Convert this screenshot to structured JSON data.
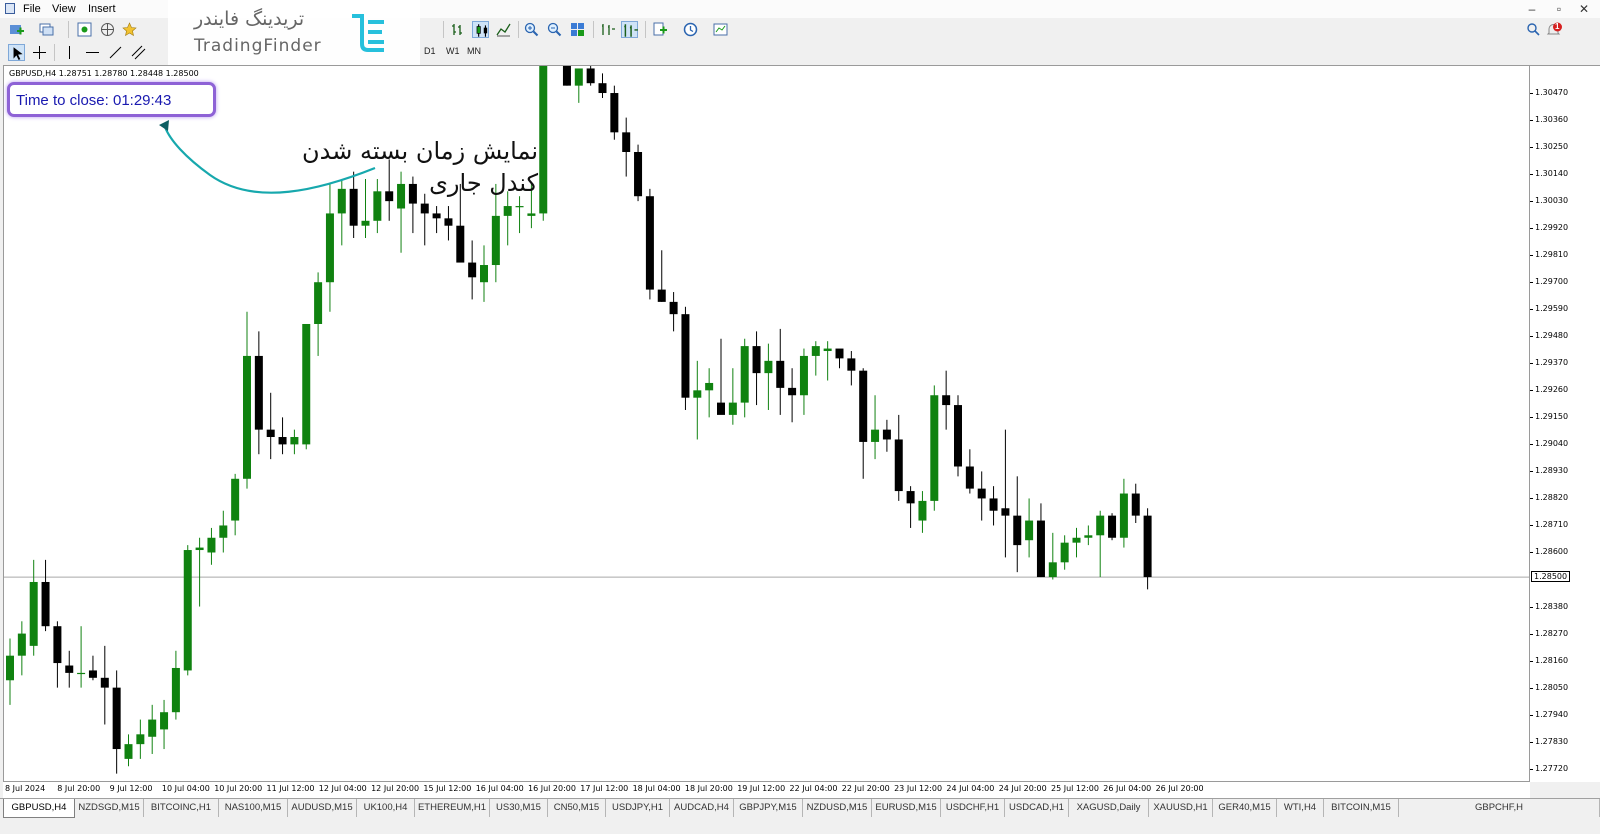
{
  "menu": {
    "items": [
      "File",
      "View",
      "Insert"
    ]
  },
  "window_buttons": {
    "minimize": "‒",
    "restore": "▫",
    "close": "✕"
  },
  "logo": {
    "fa": "تریدینگ فایندر",
    "en": "TradingFinder"
  },
  "timeframes": [
    "D1",
    "W1",
    "MN"
  ],
  "notification_badge": "1",
  "chart": {
    "title": "GBPUSD,H4  1.28751 1.28780 1.28448 1.28500",
    "current_price": "1.28500",
    "price_labels": [
      "1.30470",
      "1.30360",
      "1.30250",
      "1.30140",
      "1.30030",
      "1.29920",
      "1.29810",
      "1.29700",
      "1.29590",
      "1.29480",
      "1.29370",
      "1.29260",
      "1.29150",
      "1.29040",
      "1.28930",
      "1.28820",
      "1.28710",
      "1.28600",
      "1.28380",
      "1.28270",
      "1.28160",
      "1.28050",
      "1.27940",
      "1.27830",
      "1.27720"
    ],
    "date_labels": [
      "8 Jul 2024",
      "8 Jul 20:00",
      "9 Jul 12:00",
      "10 Jul 04:00",
      "10 Jul 20:00",
      "11 Jul 12:00",
      "12 Jul 04:00",
      "12 Jul 20:00",
      "15 Jul 12:00",
      "16 Jul 04:00",
      "16 Jul 20:00",
      "17 Jul 12:00",
      "18 Jul 04:00",
      "18 Jul 20:00",
      "19 Jul 12:00",
      "22 Jul 04:00",
      "22 Jul 20:00",
      "23 Jul 12:00",
      "24 Jul 04:00",
      "24 Jul 20:00",
      "25 Jul 12:00",
      "26 Jul 04:00",
      "26 Jul 20:00"
    ],
    "up_color": "#108210",
    "down_color": "#000000",
    "price_line_color": "#a9a9a9"
  },
  "indicator": {
    "time_to_close": "Time to close: 01:29:43",
    "highlight_color": "#8e62d6"
  },
  "annotation": {
    "line1": "نمایش زمان بسته شدن",
    "line2": "کندل جاری"
  },
  "tabs": [
    "GBPUSD,H4",
    "NZDSGD,M15",
    "BITCOINC,H1",
    "NAS100,M15",
    "AUDUSD,M15",
    "UK100,H4",
    "ETHEREUM,H1",
    "US30,M15",
    "CN50,M15",
    "USDJPY,H1",
    "AUDCAD,H4",
    "GBPJPY,M15",
    "NZDUSD,M15",
    "EURUSD,M15",
    "USDCHF,H1",
    "USDCAD,H1",
    "XAGUSD,Daily",
    "XAUUSD,H1",
    "GER40,M15",
    "WTI,H4",
    "BITCOIN,M15",
    "GBPCHF,H"
  ],
  "chart_data": {
    "type": "candlestick",
    "title": "GBPUSD,H4",
    "ohlc_header": {
      "open": 1.28751,
      "high": 1.2878,
      "low": 1.28448,
      "close": 1.285
    },
    "current_price": 1.285,
    "ylim": [
      1.2767,
      1.3058
    ],
    "xlabels": [
      "8 Jul 2024",
      "8 Jul 20:00",
      "9 Jul 12:00",
      "10 Jul 04:00",
      "10 Jul 20:00",
      "11 Jul 12:00",
      "12 Jul 04:00",
      "12 Jul 20:00",
      "15 Jul 12:00",
      "16 Jul 04:00",
      "16 Jul 20:00",
      "17 Jul 12:00",
      "18 Jul 04:00",
      "18 Jul 20:00",
      "19 Jul 12:00",
      "22 Jul 04:00",
      "22 Jul 20:00",
      "23 Jul 12:00",
      "24 Jul 04:00",
      "24 Jul 20:00",
      "25 Jul 12:00",
      "26 Jul 04:00",
      "26 Jul 20:00"
    ],
    "candles": [
      [
        1.2808,
        1.2825,
        1.2798,
        1.2818
      ],
      [
        1.2818,
        1.2832,
        1.281,
        1.2827
      ],
      [
        1.2822,
        1.2857,
        1.2818,
        1.2848
      ],
      [
        1.2848,
        1.2857,
        1.2828,
        1.283
      ],
      [
        1.283,
        1.2832,
        1.2805,
        1.2815
      ],
      [
        1.2814,
        1.282,
        1.2805,
        1.2811
      ],
      [
        1.2811,
        1.283,
        1.2805,
        1.2811
      ],
      [
        1.2812,
        1.2818,
        1.2808,
        1.2809
      ],
      [
        1.2809,
        1.2822,
        1.279,
        1.2805
      ],
      [
        1.2805,
        1.2812,
        1.277,
        1.278
      ],
      [
        1.2776,
        1.2786,
        1.2773,
        1.2782
      ],
      [
        1.2782,
        1.2792,
        1.2776,
        1.2786
      ],
      [
        1.2785,
        1.2798,
        1.2778,
        1.2792
      ],
      [
        1.2788,
        1.28,
        1.278,
        1.2795
      ],
      [
        1.2795,
        1.282,
        1.2792,
        1.2813
      ],
      [
        1.2812,
        1.2863,
        1.281,
        1.2861
      ],
      [
        1.2861,
        1.2866,
        1.2838,
        1.2862
      ],
      [
        1.286,
        1.287,
        1.2855,
        1.2866
      ],
      [
        1.2866,
        1.2877,
        1.286,
        1.2871
      ],
      [
        1.2873,
        1.2892,
        1.2867,
        1.289
      ],
      [
        1.289,
        1.2958,
        1.2886,
        1.294
      ],
      [
        1.294,
        1.295,
        1.29,
        1.291
      ],
      [
        1.291,
        1.2925,
        1.2898,
        1.2907
      ],
      [
        1.2907,
        1.2915,
        1.29,
        1.2904
      ],
      [
        1.2904,
        1.291,
        1.29,
        1.2907
      ],
      [
        1.2904,
        1.2945,
        1.2902,
        1.2953
      ],
      [
        1.2953,
        1.2974,
        1.294,
        1.297
      ],
      [
        1.297,
        1.301,
        1.2958,
        1.2998
      ],
      [
        1.2998,
        1.3012,
        1.2985,
        1.3008
      ],
      [
        1.3008,
        1.3015,
        1.2988,
        1.2993
      ],
      [
        1.2993,
        1.3012,
        1.2988,
        1.2995
      ],
      [
        1.2995,
        1.3012,
        1.299,
        1.3007
      ],
      [
        1.3007,
        1.302,
        1.2995,
        1.3003
      ],
      [
        1.3,
        1.3015,
        1.2982,
        1.301
      ],
      [
        1.301,
        1.3013,
        1.299,
        1.3002
      ],
      [
        1.3002,
        1.3006,
        1.2985,
        1.2998
      ],
      [
        1.2998,
        1.3001,
        1.299,
        1.2996
      ],
      [
        1.2996,
        1.3001,
        1.2987,
        1.2993
      ],
      [
        1.2993,
        1.301,
        1.298,
        1.2978
      ],
      [
        1.2978,
        1.2987,
        1.2963,
        1.2972
      ],
      [
        1.297,
        1.2985,
        1.2962,
        1.2977
      ],
      [
        1.2977,
        1.301,
        1.297,
        1.2997
      ],
      [
        1.2997,
        1.3007,
        1.2985,
        1.3001
      ],
      [
        1.3001,
        1.3005,
        1.299,
        1.3001
      ],
      [
        1.2997,
        1.301,
        1.2992,
        1.2998
      ],
      [
        1.2998,
        1.3088,
        1.2995,
        1.308
      ],
      [
        1.308,
        1.3103,
        1.307,
        1.3085
      ],
      [
        1.3085,
        1.3087,
        1.305,
        1.305
      ],
      [
        1.305,
        1.3052,
        1.3043,
        1.3057
      ],
      [
        1.3057,
        1.306,
        1.305,
        1.3051
      ],
      [
        1.3051,
        1.3055,
        1.3045,
        1.3047
      ],
      [
        1.3047,
        1.305,
        1.3028,
        1.3031
      ],
      [
        1.3031,
        1.3037,
        1.3013,
        1.3023
      ],
      [
        1.3023,
        1.3026,
        1.3003,
        1.3005
      ],
      [
        1.3005,
        1.3008,
        1.2963,
        1.2967
      ],
      [
        1.2967,
        1.2983,
        1.2962,
        1.2962
      ],
      [
        1.2962,
        1.2966,
        1.295,
        1.2957
      ],
      [
        1.2957,
        1.296,
        1.2918,
        1.2923
      ],
      [
        1.2923,
        1.2938,
        1.2906,
        1.2926
      ],
      [
        1.2926,
        1.2935,
        1.2915,
        1.2929
      ],
      [
        1.2921,
        1.2947,
        1.2917,
        1.2916
      ],
      [
        1.2916,
        1.2935,
        1.2912,
        1.2921
      ],
      [
        1.2921,
        1.2947,
        1.2915,
        1.2944
      ],
      [
        1.2944,
        1.295,
        1.292,
        1.2933
      ],
      [
        1.2933,
        1.2945,
        1.2918,
        1.2938
      ],
      [
        1.2938,
        1.2951,
        1.2916,
        1.2927
      ],
      [
        1.2927,
        1.2935,
        1.2913,
        1.2924
      ],
      [
        1.2924,
        1.2943,
        1.2916,
        1.294
      ],
      [
        1.294,
        1.2946,
        1.2932,
        1.2944
      ],
      [
        1.2942,
        1.2946,
        1.293,
        1.2943
      ],
      [
        1.2943,
        1.2942,
        1.2935,
        1.2939
      ],
      [
        1.2939,
        1.2942,
        1.2928,
        1.2934
      ],
      [
        1.2934,
        1.2935,
        1.289,
        1.2905
      ],
      [
        1.2905,
        1.2924,
        1.2898,
        1.291
      ],
      [
        1.291,
        1.2914,
        1.2901,
        1.2906
      ],
      [
        1.2906,
        1.2916,
        1.2881,
        1.2885
      ],
      [
        1.2885,
        1.2887,
        1.287,
        1.288
      ],
      [
        1.2873,
        1.2885,
        1.2868,
        1.2881
      ],
      [
        1.2881,
        1.2928,
        1.2877,
        1.2924
      ],
      [
        1.2924,
        1.2934,
        1.291,
        1.292
      ],
      [
        1.292,
        1.2924,
        1.2891,
        1.2895
      ],
      [
        1.2895,
        1.2902,
        1.2884,
        1.2886
      ],
      [
        1.2886,
        1.2893,
        1.2873,
        1.2882
      ],
      [
        1.2882,
        1.2887,
        1.2871,
        1.2877
      ],
      [
        1.2878,
        1.291,
        1.2858,
        1.2875
      ],
      [
        1.2875,
        1.2891,
        1.2852,
        1.2863
      ],
      [
        1.2865,
        1.2882,
        1.2858,
        1.2873
      ],
      [
        1.2873,
        1.288,
        1.285,
        1.285
      ],
      [
        1.285,
        1.2868,
        1.2849,
        1.2856
      ],
      [
        1.2856,
        1.2867,
        1.2853,
        1.2864
      ],
      [
        1.2864,
        1.287,
        1.2858,
        1.2866
      ],
      [
        1.2866,
        1.2871,
        1.2863,
        1.2867
      ],
      [
        1.2867,
        1.2877,
        1.285,
        1.2875
      ],
      [
        1.2875,
        1.2876,
        1.2865,
        1.2866
      ],
      [
        1.2866,
        1.289,
        1.2862,
        1.2884
      ],
      [
        1.2884,
        1.2888,
        1.2872,
        1.2875
      ],
      [
        1.2875,
        1.2878,
        1.2845,
        1.285
      ]
    ]
  }
}
